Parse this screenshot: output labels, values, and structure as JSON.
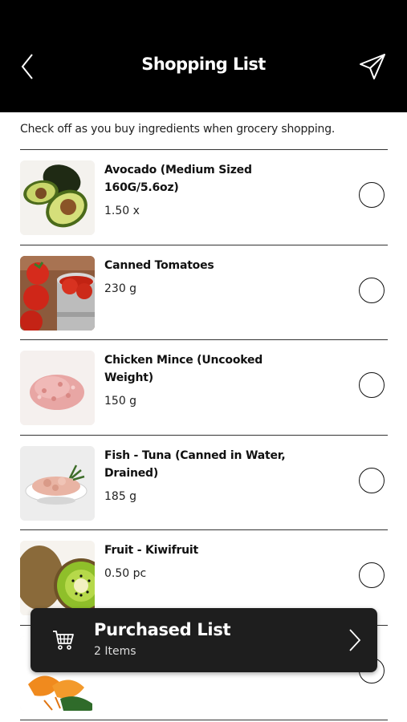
{
  "header": {
    "title": "Shopping List",
    "back_icon": "chevron-left-icon",
    "send_icon": "paper-plane-icon"
  },
  "intro": "Check off as you buy ingredients when grocery shopping.",
  "items": [
    {
      "name": "Avocado (Medium Sized 160G/5.6oz)",
      "qty": "1.50 x",
      "image": "avocado"
    },
    {
      "name": "Canned Tomatoes",
      "qty": "230 g",
      "image": "canned-tomatoes"
    },
    {
      "name": "Chicken Mince (Uncooked Weight)",
      "qty": "150 g",
      "image": "chicken-mince"
    },
    {
      "name": "Fish - Tuna (Canned in Water, Drained)",
      "qty": "185 g",
      "image": "tuna"
    },
    {
      "name": "Fruit - Kiwifruit",
      "qty": "0.50 pc",
      "image": "kiwifruit"
    },
    {
      "name": "",
      "qty": "",
      "image": "mandarin"
    }
  ],
  "purchased": {
    "title": "Purchased List",
    "subtitle": "2 Items",
    "icon": "shopping-cart-icon",
    "chevron": "chevron-right-icon"
  }
}
